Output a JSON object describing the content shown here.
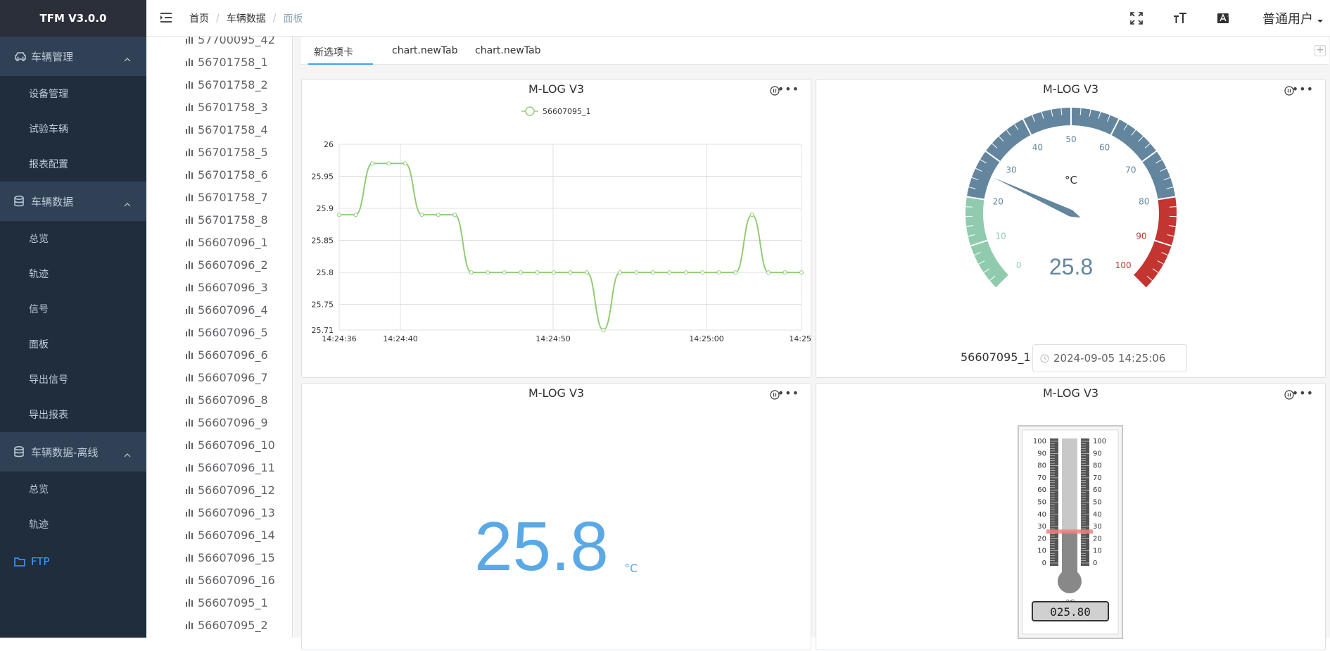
{
  "brand": "TFM V3.0.0",
  "sidebar": {
    "groups": [
      {
        "label": "车辆管理",
        "icon": "car-icon",
        "items": [
          "设备管理",
          "试验车辆",
          "报表配置"
        ]
      },
      {
        "label": "车辆数据",
        "icon": "database-icon",
        "items": [
          "总览",
          "轨迹",
          "信号",
          "面板",
          "导出信号",
          "导出报表"
        ]
      },
      {
        "label": "车辆数据-离线",
        "icon": "database-icon",
        "items": [
          "总览",
          "轨迹"
        ]
      },
      {
        "label": "FTP",
        "icon": "folder-icon",
        "items": []
      }
    ]
  },
  "header": {
    "breadcrumb": [
      "首页",
      "车辆数据",
      "面板"
    ],
    "user": "普通用户",
    "icons": [
      "fullscreen-icon",
      "font-size-icon",
      "translate-icon"
    ]
  },
  "tree": {
    "items": [
      "57700095_42",
      "56701758_1",
      "56701758_2",
      "56701758_3",
      "56701758_4",
      "56701758_5",
      "56701758_6",
      "56701758_7",
      "56701758_8",
      "56607096_1",
      "56607096_2",
      "56607096_3",
      "56607096_4",
      "56607096_5",
      "56607096_6",
      "56607096_7",
      "56607096_8",
      "56607096_9",
      "56607096_10",
      "56607096_11",
      "56607096_12",
      "56607096_13",
      "56607096_14",
      "56607096_15",
      "56607096_16",
      "56607095_1",
      "56607095_2"
    ]
  },
  "tabs": [
    "新选项卡",
    "chart.newTab",
    "chart.newTab"
  ],
  "cards": {
    "line_title": "M-LOG V3",
    "gauge_title": "M-LOG V3",
    "digital_title": "M-LOG V3",
    "thermo_title": "M-LOG V3"
  },
  "gauge": {
    "unit": "°C",
    "value_label": "25.8",
    "signal": "56607095_1",
    "timestamp": "2024-09-05 14:25:06",
    "ticks": [
      "0",
      "10",
      "20",
      "30",
      "40",
      "50",
      "60",
      "70",
      "80",
      "90",
      "100"
    ]
  },
  "digital": {
    "value": "25.8",
    "unit": "°C"
  },
  "thermometer": {
    "unit": "°C",
    "readout": "025.80",
    "ticks": [
      "100",
      "90",
      "80",
      "70",
      "60",
      "50",
      "40",
      "30",
      "20",
      "10",
      "0"
    ],
    "value": 25.8
  },
  "chart_data": {
    "type": "line",
    "title": "M-LOG V3",
    "series": [
      {
        "name": "56607095_1",
        "color": "#91cc75",
        "values": [
          25.89,
          25.89,
          25.97,
          25.97,
          25.97,
          25.89,
          25.89,
          25.89,
          25.8,
          25.8,
          25.8,
          25.8,
          25.8,
          25.8,
          25.8,
          25.8,
          25.71,
          25.8,
          25.8,
          25.8,
          25.8,
          25.8,
          25.8,
          25.8,
          25.8,
          25.89,
          25.8,
          25.8,
          25.8
        ]
      }
    ],
    "xticks": [
      "14:24:36",
      "14:24:40",
      "14:24:50",
      "14:25:00",
      "14:25:"
    ],
    "yticks": [
      "26",
      "25.95",
      "25.9",
      "25.85",
      "25.8",
      "25.75",
      "25.71"
    ],
    "ylim": [
      25.71,
      26
    ]
  }
}
